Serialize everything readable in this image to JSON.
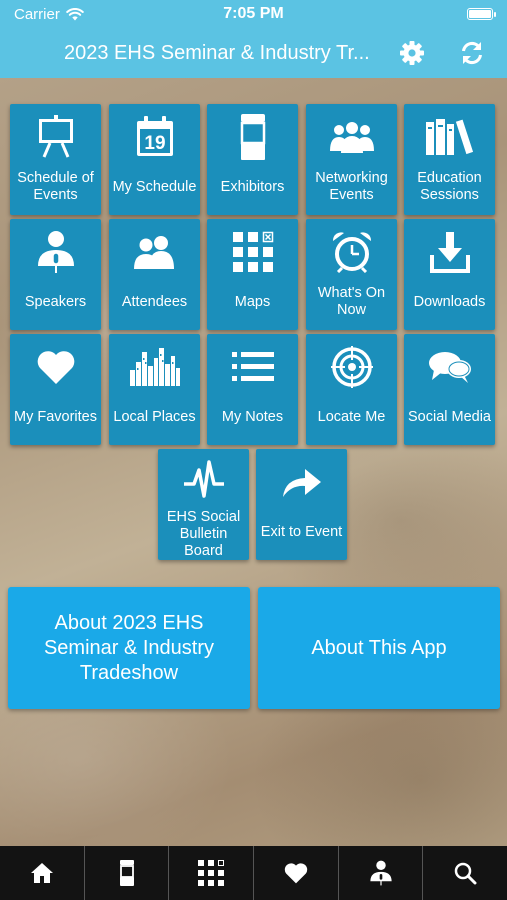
{
  "status_bar": {
    "carrier": "Carrier",
    "time": "7:05 PM"
  },
  "nav": {
    "title": "2023 EHS Seminar & Industry Tr..."
  },
  "tiles": [
    {
      "label": "Schedule of Events",
      "icon": "easel-icon"
    },
    {
      "label": "My Schedule",
      "icon": "calendar-icon",
      "calendar_day": "19"
    },
    {
      "label": "Exhibitors",
      "icon": "booth-icon"
    },
    {
      "label": "Networking Events",
      "icon": "people-group-icon"
    },
    {
      "label": "Education Sessions",
      "icon": "books-icon"
    },
    {
      "label": "Speakers",
      "icon": "speaker-icon"
    },
    {
      "label": "Attendees",
      "icon": "attendees-icon"
    },
    {
      "label": "Maps",
      "icon": "floor-map-icon"
    },
    {
      "label": "What's On Now",
      "icon": "alarm-clock-icon"
    },
    {
      "label": "Downloads",
      "icon": "download-icon"
    },
    {
      "label": "My Favorites",
      "icon": "heart-icon"
    },
    {
      "label": "Local Places",
      "icon": "city-skyline-icon"
    },
    {
      "label": "My Notes",
      "icon": "list-icon"
    },
    {
      "label": "Locate Me",
      "icon": "target-icon"
    },
    {
      "label": "Social Media",
      "icon": "chat-bubbles-icon"
    },
    {
      "label": "EHS Social Bulletin Board",
      "icon": "pulse-icon"
    },
    {
      "label": "Exit to Event",
      "icon": "share-arrow-icon"
    }
  ],
  "buttons": {
    "about_event": "About 2023 EHS Seminar & Industry Tradeshow",
    "about_app": "About This App"
  },
  "tab_bar": [
    {
      "name": "home",
      "icon": "home-icon"
    },
    {
      "name": "exhibitors",
      "icon": "booth-icon"
    },
    {
      "name": "maps",
      "icon": "floor-map-icon"
    },
    {
      "name": "favorites",
      "icon": "heart-icon"
    },
    {
      "name": "speakers",
      "icon": "speaker-icon"
    },
    {
      "name": "search",
      "icon": "search-icon"
    }
  ]
}
